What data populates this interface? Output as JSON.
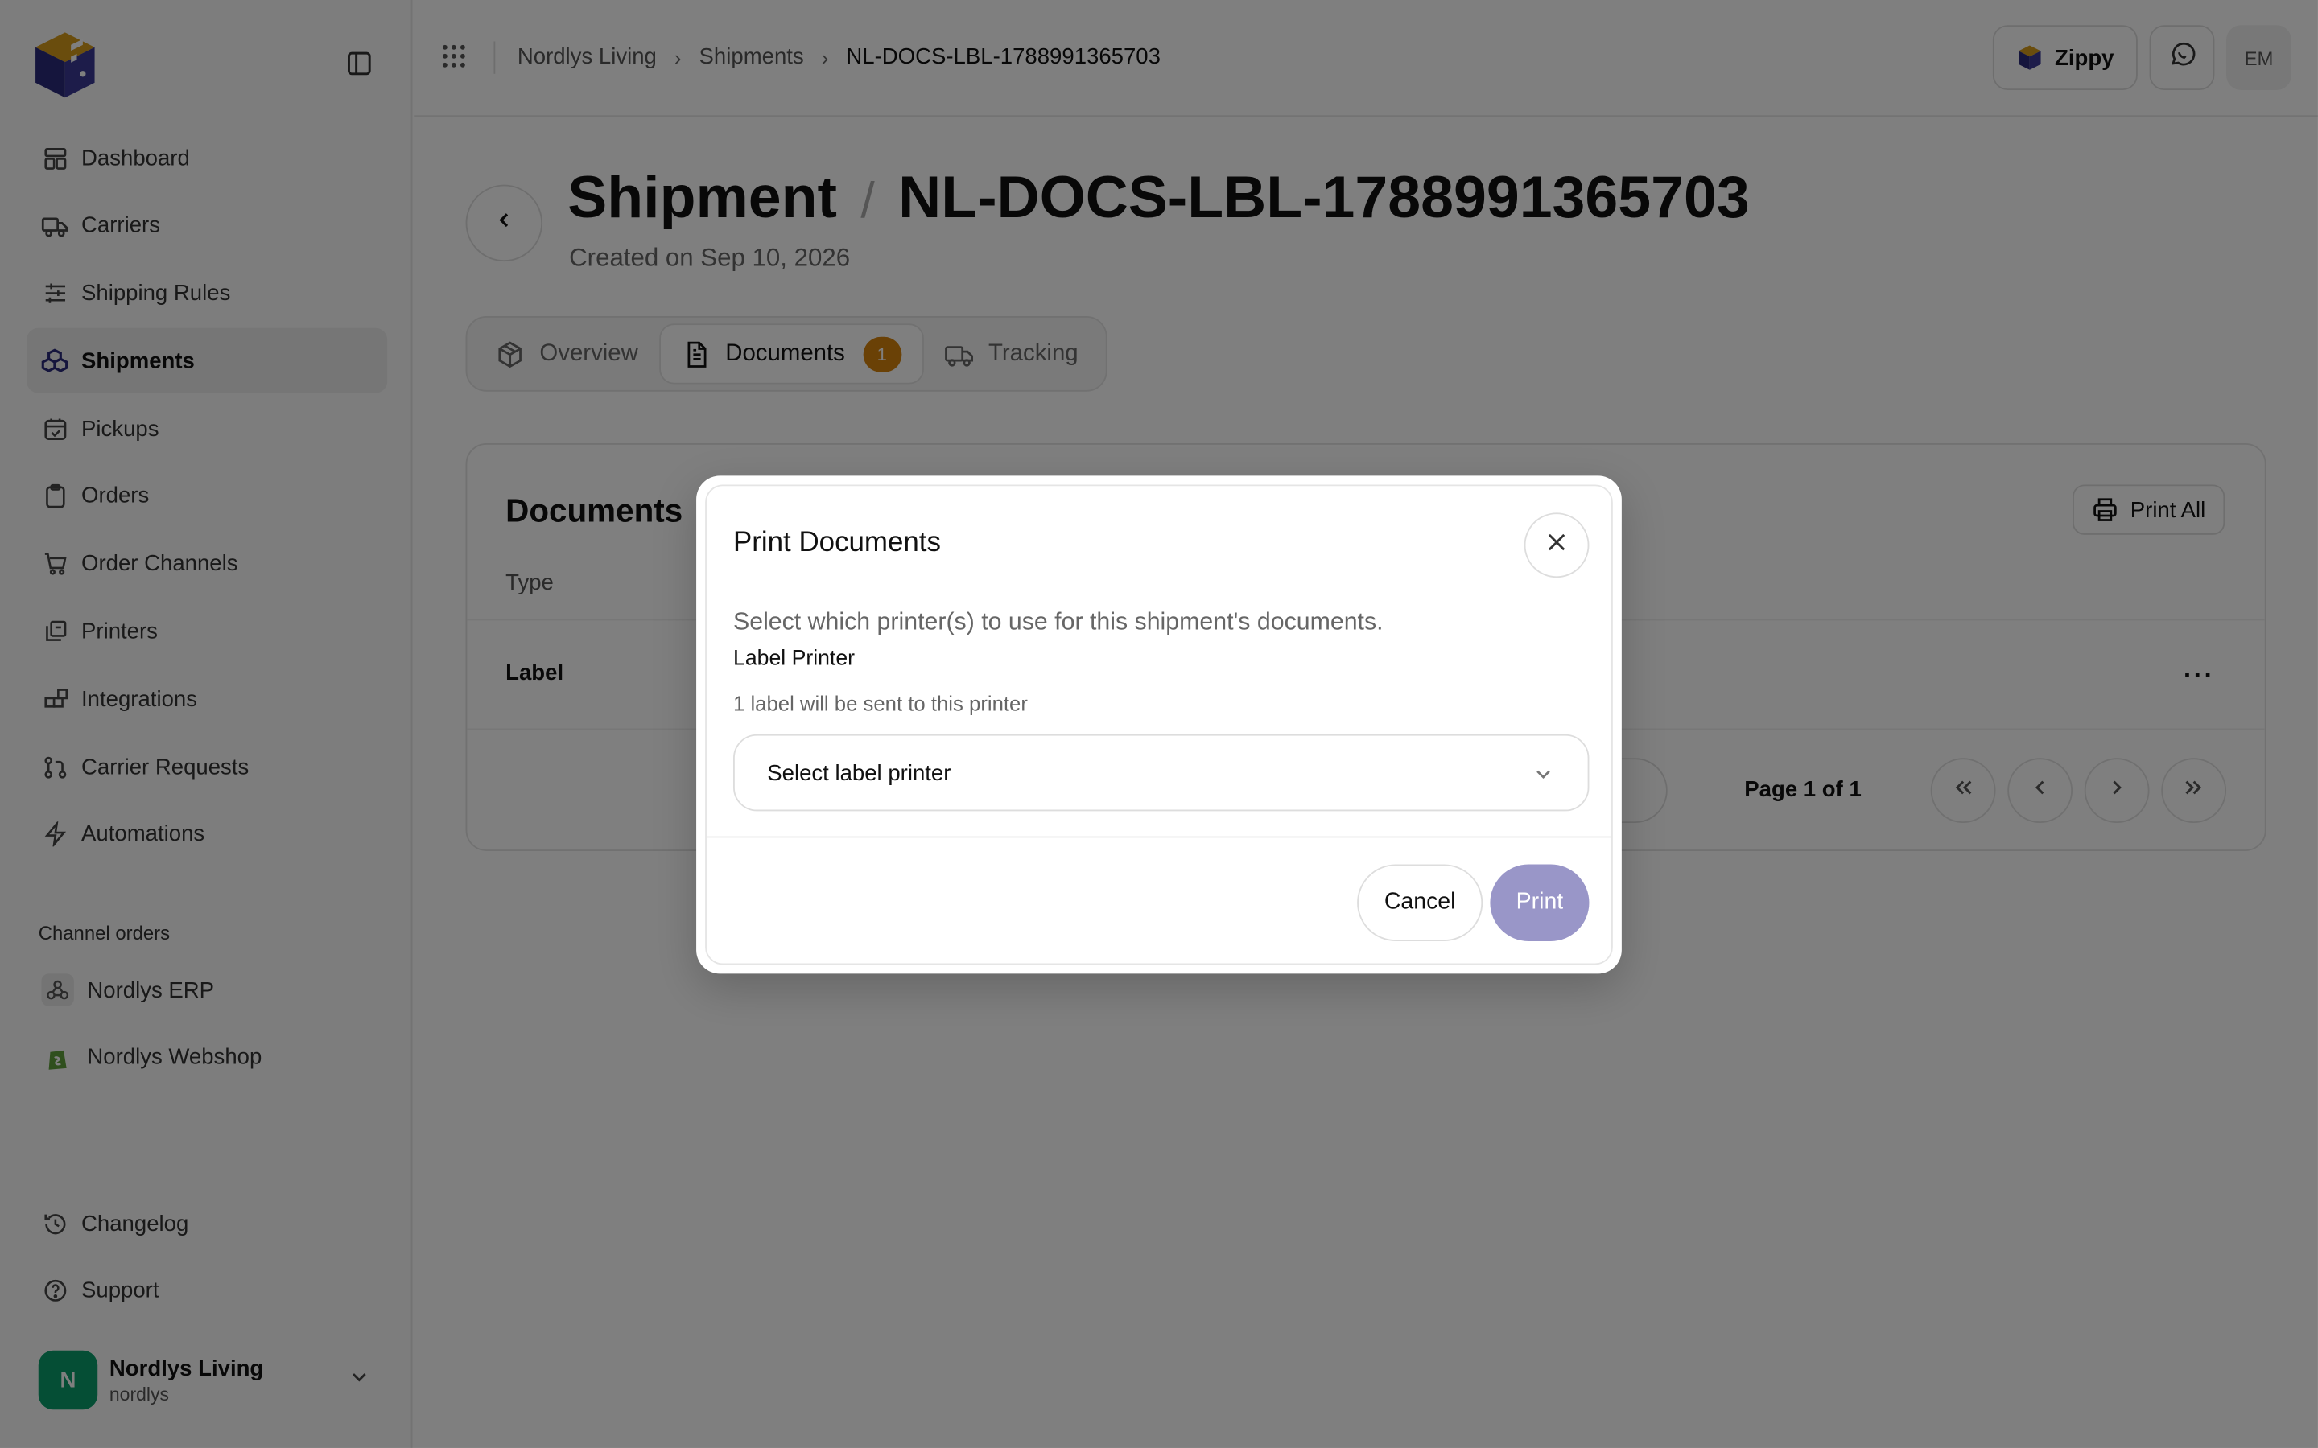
{
  "colors": {
    "brand_purple": "#2b2a7a",
    "brand_gold": "#d49a1a",
    "badge": "#d4820c",
    "print_button": "#9996c8",
    "avatar_green": "#0a9d6b",
    "overlay": "rgba(0,0,0,0.5)"
  },
  "sidebar": {
    "items": [
      {
        "label": "Dashboard",
        "icon": "dashboard-icon"
      },
      {
        "label": "Carriers",
        "icon": "truck-icon"
      },
      {
        "label": "Shipping Rules",
        "icon": "sliders-icon"
      },
      {
        "label": "Shipments",
        "icon": "boxes-icon",
        "active": true
      },
      {
        "label": "Pickups",
        "icon": "calendar-check-icon"
      },
      {
        "label": "Orders",
        "icon": "clipboard-icon"
      },
      {
        "label": "Order Channels",
        "icon": "cart-icon"
      },
      {
        "label": "Printers",
        "icon": "printers-icon"
      },
      {
        "label": "Integrations",
        "icon": "blocks-icon"
      },
      {
        "label": "Carrier Requests",
        "icon": "git-pull-request-icon"
      },
      {
        "label": "Automations",
        "icon": "zap-icon"
      }
    ],
    "section_label": "Channel orders",
    "channels": [
      {
        "label": "Nordlys ERP",
        "icon": "webhook-icon"
      },
      {
        "label": "Nordlys Webshop",
        "icon": "shopify-icon"
      }
    ],
    "bottom": [
      {
        "label": "Changelog",
        "icon": "history-icon"
      },
      {
        "label": "Support",
        "icon": "help-circle-icon"
      }
    ],
    "account": {
      "initial": "N",
      "name": "Nordlys Living",
      "sub": "nordlys"
    }
  },
  "header": {
    "breadcrumb": [
      "Nordlys Living",
      "Shipments",
      "NL-DOCS-LBL-1788991365703"
    ],
    "brand_button": "Zippy",
    "user_initials": "EM"
  },
  "page": {
    "title": "Shipment",
    "title_id": "NL-DOCS-LBL-1788991365703",
    "subtitle": "Created on Sep 10, 2026",
    "tabs": [
      {
        "label": "Overview",
        "icon": "package-icon"
      },
      {
        "label": "Documents",
        "icon": "file-text-icon",
        "badge": "1",
        "active": true
      },
      {
        "label": "Tracking",
        "icon": "truck-icon"
      }
    ]
  },
  "documents": {
    "title": "Documents",
    "print_all": "Print All",
    "column_type": "Type",
    "rows": [
      {
        "type": "Label"
      }
    ],
    "page_info": "Page 1 of 1"
  },
  "modal": {
    "title": "Print Documents",
    "description": "Select which printer(s) to use for this shipment's documents.",
    "field_label": "Label Printer",
    "field_hint": "1 label will be sent to this printer",
    "select_placeholder": "Select label printer",
    "cancel": "Cancel",
    "print": "Print"
  }
}
